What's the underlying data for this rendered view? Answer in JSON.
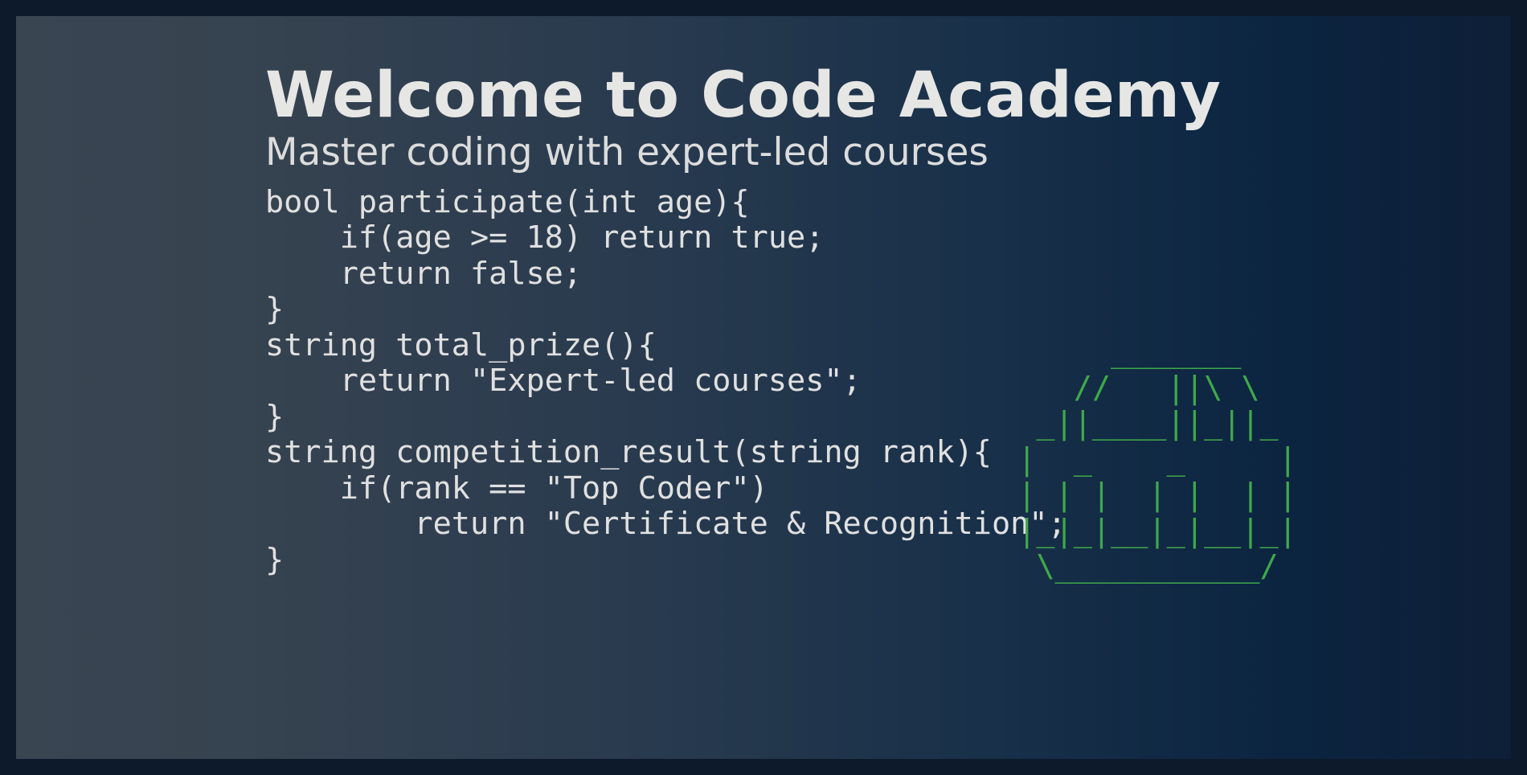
{
  "hero": {
    "title": "Welcome to Code Academy",
    "subtitle": "Master coding with expert-led courses"
  },
  "code_snippet": {
    "lines": [
      "bool participate(int age){",
      "    if(age >= 18) return true;",
      "    return false;",
      "}",
      "string total_prize(){",
      "    return \"Expert-led courses\";",
      "}",
      "string competition_result(string rank){",
      "    if(rank == \"Top Coder\")",
      "        return \"Certificate & Recognition\";",
      "}"
    ]
  },
  "ascii_art": {
    "name": "building-ascii-art",
    "color": "#3fa94a",
    "lines": [
      "      _______",
      "    //   ||\\ \\",
      "  _||____||_||_",
      " |  _    _     |",
      " | | |  | |  | |",
      " |_|_|__|_|__|_|",
      "  \\___________/"
    ]
  },
  "colors": {
    "frame": "#0d1a2b",
    "text": "#e6e6e4",
    "ascii": "#3fa94a"
  }
}
